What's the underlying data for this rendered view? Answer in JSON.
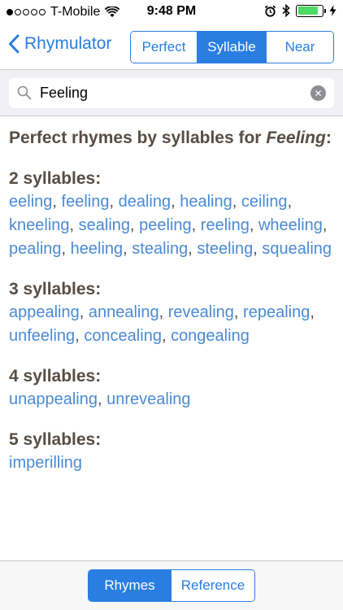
{
  "status": {
    "carrier": "T-Mobile",
    "time": "9:48 PM",
    "signal_dots_filled": 1,
    "signal_dots_total": 5,
    "battery_level": 0.85
  },
  "nav": {
    "back_label": "Rhymulator",
    "segments": [
      {
        "label": "Perfect",
        "active": false
      },
      {
        "label": "Syllable",
        "active": true
      },
      {
        "label": "Near",
        "active": false
      }
    ]
  },
  "search": {
    "value": "Feeling",
    "placeholder": ""
  },
  "content": {
    "heading_prefix": "Perfect rhymes by syllables for",
    "heading_word": "Feeling",
    "heading_suffix": ":",
    "groups": [
      {
        "title": "2 syllables:",
        "words": [
          "eeling",
          "feeling",
          "dealing",
          "healing",
          "ceiling",
          "kneeling",
          "sealing",
          "peeling",
          "reeling",
          "wheeling",
          "pealing",
          "heeling",
          "stealing",
          "steeling",
          "squealing"
        ]
      },
      {
        "title": "3 syllables:",
        "words": [
          "appealing",
          "annealing",
          "revealing",
          "repealing",
          "unfeeling",
          "concealing",
          "congealing"
        ]
      },
      {
        "title": "4 syllables:",
        "words": [
          "unappealing",
          "unrevealing"
        ]
      },
      {
        "title": "5 syllables:",
        "words": [
          "imperilling"
        ]
      }
    ]
  },
  "bottom_tabs": [
    {
      "label": "Rhymes",
      "active": true
    },
    {
      "label": "Reference",
      "active": false
    }
  ],
  "colors": {
    "accent": "#2a7de1",
    "link": "#4a8ad4",
    "heading": "#574d44",
    "battery": "#4cd964"
  },
  "icons": {
    "wifi": "wifi-icon",
    "alarm": "alarm-clock-icon",
    "bluetooth": "bluetooth-icon",
    "charging": "charging-bolt-icon",
    "back": "chevron-left-icon",
    "search": "search-icon",
    "clear": "clear-icon"
  }
}
